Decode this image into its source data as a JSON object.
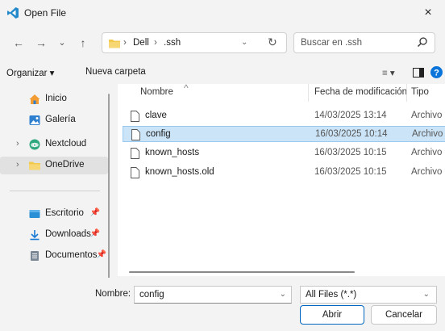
{
  "window": {
    "title": "Open File",
    "close_symbol": "×"
  },
  "nav": {
    "back": "←",
    "forward": "→",
    "recent": "⌄",
    "up": "↑",
    "breadcrumbs": [
      "Dell",
      ".ssh"
    ],
    "crumb_sep": "›",
    "search_placeholder": "Buscar en .ssh"
  },
  "toolbar": {
    "organize_label": "Organizar ▾",
    "new_folder_label": "Nueva carpeta",
    "view_label": "≡ ▾"
  },
  "sidebar": {
    "items": [
      {
        "label": "Inicio",
        "icon": "home-icon"
      },
      {
        "label": "Galería",
        "icon": "gallery-icon"
      },
      {
        "label": "Nextcloud",
        "icon": "nextcloud-icon"
      },
      {
        "label": "OneDrive",
        "icon": "onedrive-folder-icon"
      },
      {
        "label": "Escritorio",
        "icon": "desktop-icon"
      },
      {
        "label": "Downloads",
        "icon": "downloads-icon"
      },
      {
        "label": "Documentos",
        "icon": "documents-icon"
      }
    ]
  },
  "columns": {
    "name": "Nombre",
    "date": "Fecha de modificación",
    "type": "Tipo"
  },
  "files": [
    {
      "name": "clave",
      "date": "14/03/2025 13:14",
      "type": "Archivo"
    },
    {
      "name": "config",
      "date": "16/03/2025 10:14",
      "type": "Archivo"
    },
    {
      "name": "known_hosts",
      "date": "16/03/2025 10:15",
      "type": "Archivo"
    },
    {
      "name": "known_hosts.old",
      "date": "16/03/2025 10:15",
      "type": "Archivo"
    }
  ],
  "selected_file_index": 1,
  "bottom": {
    "filename_label": "Nombre:",
    "filename_value": "config",
    "filter_value": "All Files (*.*)",
    "open_label": "Abrir",
    "cancel_label": "Cancelar"
  },
  "colors": {
    "accent": "#0067c0",
    "selection_bg": "#cce4f7",
    "selection_border": "#99c9ef"
  }
}
